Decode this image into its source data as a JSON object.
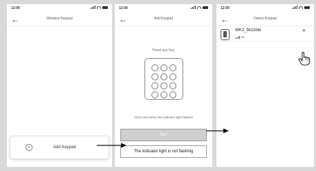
{
  "screen1": {
    "time": "12:00",
    "title": "Wireless Keypad",
    "add_label": "Add Keypad"
  },
  "screen2": {
    "time": "12:00",
    "title": "Add Keypad",
    "press_label": "Press any Key",
    "hint": "Click Next when the indicator light flashes",
    "next_label": "Next",
    "not_flashing_label": "The indicator light is not flashing"
  },
  "screen3": {
    "time": "12:00",
    "title": "Detect Keypad",
    "device_name": "WK3_9e11ble",
    "device_signal": "90",
    "add_symbol": "+"
  },
  "icons": {
    "back": "back-arrow-icon",
    "add": "plus-circle-icon",
    "keypad": "keypad-icon",
    "device": "keypad-device-icon",
    "pointer": "hand-pointer-icon"
  }
}
